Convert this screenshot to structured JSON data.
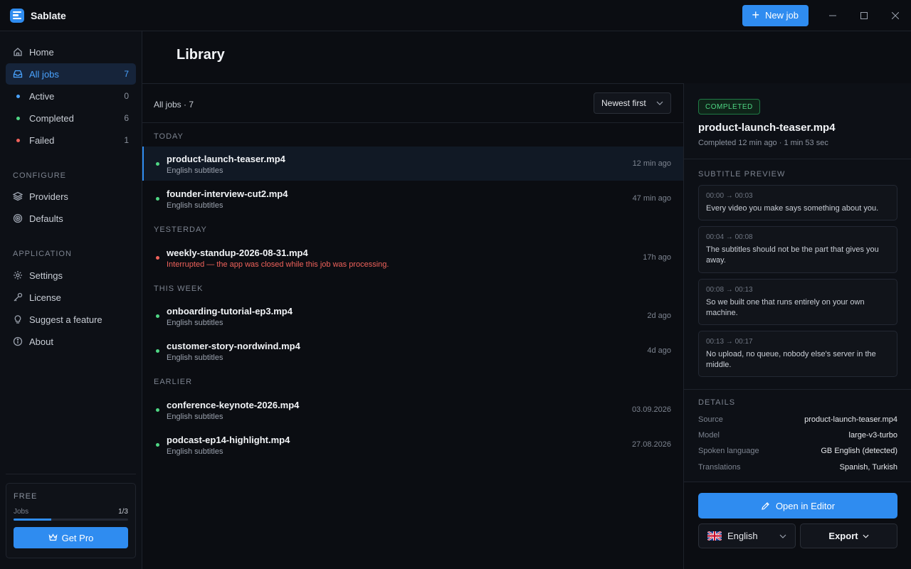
{
  "titlebar": {
    "app_name": "Sablate",
    "new_job_label": "New job",
    "minimize": "—",
    "maximize": "☐",
    "close": "✕"
  },
  "sidebar": {
    "home": "Home",
    "all_jobs": {
      "label": "All jobs",
      "count": "7"
    },
    "active": {
      "label": "Active",
      "count": "0"
    },
    "completed": {
      "label": "Completed",
      "count": "6"
    },
    "failed": {
      "label": "Failed",
      "count": "1"
    },
    "configure_label": "CONFIGURE",
    "providers": "Providers",
    "defaults": "Defaults",
    "application_label": "APPLICATION",
    "settings": "Settings",
    "license": "License",
    "suggest": "Suggest a feature",
    "about": "About",
    "plan": {
      "name": "FREE",
      "usage_label": "Jobs",
      "usage_value": "1/3",
      "usage_fraction": 0.33,
      "cta": "Get Pro"
    }
  },
  "main": {
    "title": "Library",
    "list_header": "All jobs · 7",
    "sort_label": "Newest first",
    "groups": {
      "today": "TODAY",
      "yesterday": "YESTERDAY",
      "this_week": "THIS WEEK",
      "earlier": "EARLIER"
    },
    "jobs": [
      {
        "name": "product-launch-teaser.mp4",
        "sub": "English subtitles",
        "time": "12 min ago",
        "status": "completed"
      },
      {
        "name": "founder-interview-cut2.mp4",
        "sub": "English subtitles",
        "time": "47 min ago",
        "status": "completed"
      },
      {
        "name": "weekly-standup-2026-08-31.mp4",
        "sub": "Interrupted — the app was closed while this job was processing.",
        "time": "17h ago",
        "status": "failed"
      },
      {
        "name": "onboarding-tutorial-ep3.mp4",
        "sub": "English subtitles",
        "time": "2d ago",
        "status": "completed"
      },
      {
        "name": "customer-story-nordwind.mp4",
        "sub": "English subtitles",
        "time": "4d ago",
        "status": "completed"
      },
      {
        "name": "conference-keynote-2026.mp4",
        "sub": "English subtitles",
        "time": "03.09.2026",
        "status": "completed"
      },
      {
        "name": "podcast-ep14-highlight.mp4",
        "sub": "English subtitles",
        "time": "27.08.2026",
        "status": "completed"
      }
    ]
  },
  "detail": {
    "badge": "COMPLETED",
    "title": "product-launch-teaser.mp4",
    "meta": "Completed 12 min ago · 1 min 53 sec",
    "preview_label": "SUBTITLE PREVIEW",
    "cues": [
      {
        "time": "00:00 → 00:03",
        "text": "Every video you make says something about you."
      },
      {
        "time": "00:04 → 00:08",
        "text": "The subtitles should not be the part that gives you away."
      },
      {
        "time": "00:08 → 00:13",
        "text": "So we built one that runs entirely on your own machine."
      },
      {
        "time": "00:13 → 00:17",
        "text": "No upload, no queue, nobody else's server in the middle."
      }
    ],
    "details_label": "DETAILS",
    "details": [
      {
        "key": "Source",
        "value": "product-launch-teaser.mp4"
      },
      {
        "key": "Model",
        "value": "large-v3-turbo"
      },
      {
        "key": "Spoken language",
        "value": "GB English (detected)"
      },
      {
        "key": "Translations",
        "value": "Spanish, Turkish"
      }
    ],
    "open_editor": "Open in Editor",
    "language": "English",
    "export": "Export"
  },
  "colors": {
    "accent": "#2f8cf0",
    "success": "#4fd684",
    "error": "#f0625b"
  }
}
